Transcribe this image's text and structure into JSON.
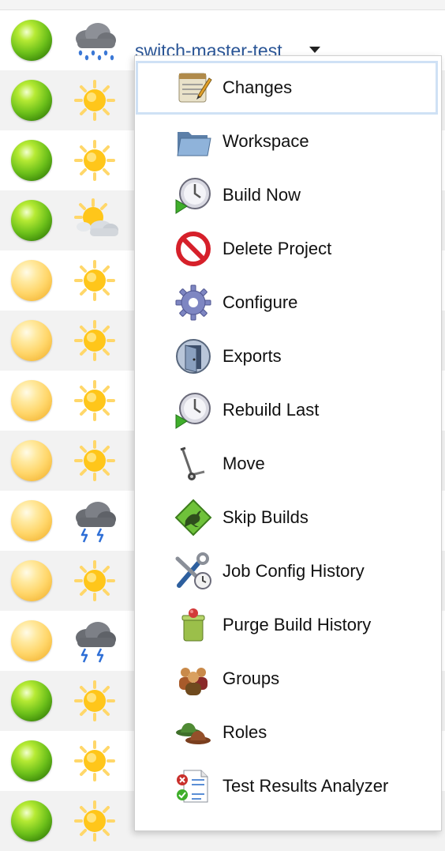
{
  "job": {
    "name": "switch-master-test"
  },
  "rows": [
    {
      "status": "green",
      "weather": "rain"
    },
    {
      "status": "green",
      "weather": "sunny"
    },
    {
      "status": "green",
      "weather": "sunny"
    },
    {
      "status": "green",
      "weather": "partly-cloudy"
    },
    {
      "status": "yellow",
      "weather": "sunny"
    },
    {
      "status": "yellow",
      "weather": "sunny"
    },
    {
      "status": "yellow",
      "weather": "sunny"
    },
    {
      "status": "yellow",
      "weather": "sunny"
    },
    {
      "status": "yellow",
      "weather": "storm"
    },
    {
      "status": "yellow",
      "weather": "sunny"
    },
    {
      "status": "yellow",
      "weather": "storm"
    },
    {
      "status": "green",
      "weather": "sunny"
    },
    {
      "status": "green",
      "weather": "sunny"
    },
    {
      "status": "green",
      "weather": "sunny"
    }
  ],
  "menu": {
    "items": [
      {
        "label": "Changes",
        "icon": "notepad-icon"
      },
      {
        "label": "Workspace",
        "icon": "folder-icon"
      },
      {
        "label": "Build Now",
        "icon": "clock-play-icon"
      },
      {
        "label": "Delete Project",
        "icon": "no-entry-icon"
      },
      {
        "label": "Configure",
        "icon": "gear-icon"
      },
      {
        "label": "Exports",
        "icon": "door-icon"
      },
      {
        "label": "Rebuild Last",
        "icon": "clock-play-icon"
      },
      {
        "label": "Move",
        "icon": "hand-truck-icon"
      },
      {
        "label": "Skip Builds",
        "icon": "kangaroo-sign-icon"
      },
      {
        "label": "Job Config History",
        "icon": "wrench-clock-icon"
      },
      {
        "label": "Purge Build History",
        "icon": "trash-can-icon"
      },
      {
        "label": "Groups",
        "icon": "people-group-icon"
      },
      {
        "label": "Roles",
        "icon": "hats-icon"
      },
      {
        "label": "Test Results Analyzer",
        "icon": "test-report-icon"
      }
    ]
  }
}
